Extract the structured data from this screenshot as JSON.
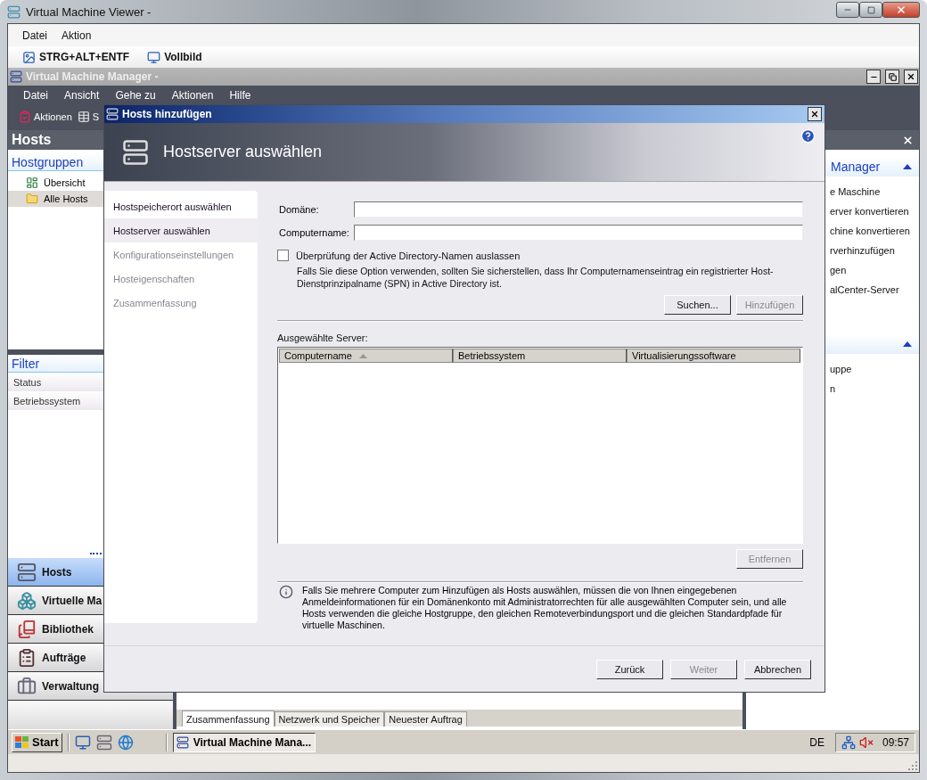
{
  "viewer": {
    "title": "Virtual Machine Viewer -",
    "menu": [
      "Datei",
      "Aktion"
    ],
    "toolbar": [
      {
        "kind": "keys",
        "label": "STRG+ALT+ENTF"
      },
      {
        "kind": "fullscreen",
        "label": "Vollbild"
      }
    ]
  },
  "manager": {
    "title": "Virtual Machine Manager -",
    "menu": [
      "Datei",
      "Ansicht",
      "Gehe zu",
      "Aktionen",
      "Hilfe"
    ],
    "toolbar": [
      {
        "kind": "actions",
        "label": "Aktionen"
      },
      {
        "kind": "table",
        "label": "S"
      }
    ],
    "left_pane": {
      "title": "Hosts",
      "section": "Hostgruppen",
      "tree": [
        {
          "kind": "overview",
          "label": "Übersicht",
          "selected": false
        },
        {
          "kind": "folder",
          "label": "Alle Hosts",
          "selected": true
        }
      ],
      "filter": {
        "title": "Filter",
        "items": [
          "Status",
          "Betriebssystem"
        ]
      },
      "nav": [
        {
          "kind": "hosts",
          "label": "Hosts",
          "selected": true
        },
        {
          "kind": "vms",
          "label": "Virtuelle Ma",
          "selected": false
        },
        {
          "kind": "library",
          "label": "Bibliothek",
          "selected": false
        },
        {
          "kind": "jobs",
          "label": "Aufträge",
          "selected": false
        },
        {
          "kind": "admin",
          "label": "Verwaltung",
          "selected": false
        }
      ]
    },
    "bottom_tabs": [
      {
        "label": "Zusammenfassung",
        "selected": true
      },
      {
        "label": "Netzwerk und Speicher",
        "selected": false
      },
      {
        "label": "Neuester Auftrag",
        "selected": false
      }
    ],
    "actions_pane": {
      "sections": [
        {
          "title": "Manager",
          "expanded": true,
          "items": [
            "e Maschine",
            "erver konvertieren",
            "chine konvertieren",
            "rverhinzufügen",
            "gen",
            "alCenter-Server"
          ]
        },
        {
          "expanded": true,
          "items": [
            "uppe",
            "n"
          ]
        }
      ]
    }
  },
  "dialog": {
    "title": "Hosts hinzufügen",
    "heading": "Hostserver auswählen",
    "steps": [
      {
        "label": "Hostspeicherort auswählen",
        "selected": false,
        "disabled": false
      },
      {
        "label": "Hostserver auswählen",
        "selected": true,
        "disabled": false
      },
      {
        "label": "Konfigurationseinstellungen",
        "selected": false,
        "disabled": true
      },
      {
        "label": "Hosteigenschaften",
        "selected": false,
        "disabled": true
      },
      {
        "label": "Zusammenfassung",
        "selected": false,
        "disabled": true
      }
    ],
    "domain": {
      "label": "Domäne:"
    },
    "computer_name": {
      "label": "Computername:"
    },
    "skip_check": {
      "label": "Überprüfung der Active Directory-Namen auslassen",
      "checked": false
    },
    "note": "Falls Sie diese Option verwenden, sollten Sie sicherstellen, dass Ihr Computernamenseintrag ein registrierter Host-Dienstprinzipalname (SPN) in Active Directory ist.",
    "search_buttons": [
      {
        "label": "Suchen...",
        "disabled": false
      },
      {
        "label": "Hinzufügen",
        "disabled": true
      }
    ],
    "servers": {
      "label": "Ausgewählte Server:",
      "columns": [
        {
          "label": "Computername",
          "sorted": true
        },
        {
          "label": "Betriebssystem",
          "sorted": false
        },
        {
          "label": "Virtualisierungssoftware",
          "sorted": false
        }
      ]
    },
    "remove_button": {
      "label": "Entfernen",
      "disabled": true
    },
    "info": "Falls Sie mehrere Computer zum Hinzufügen als Hosts auswählen, müssen die von Ihnen eingegebenen Anmeldeinformationen für ein Domänenkonto mit Administratorrechten für alle ausgewählten Computer sein, und alle Hosts verwenden die gleiche Hostgruppe, den gleichen Remoteverbindungsport und die gleichen Standardpfade für virtuelle Maschinen.",
    "footer_buttons": [
      {
        "label": "Zurück",
        "disabled": false
      },
      {
        "label": "Weiter",
        "disabled": true
      },
      {
        "label": "Abbrechen",
        "disabled": false
      }
    ]
  },
  "taskbar": {
    "start": "Start",
    "tasks": [
      {
        "label": "Virtual Machine Mana...",
        "selected": true
      }
    ],
    "language": "DE",
    "clock": "09:57"
  }
}
